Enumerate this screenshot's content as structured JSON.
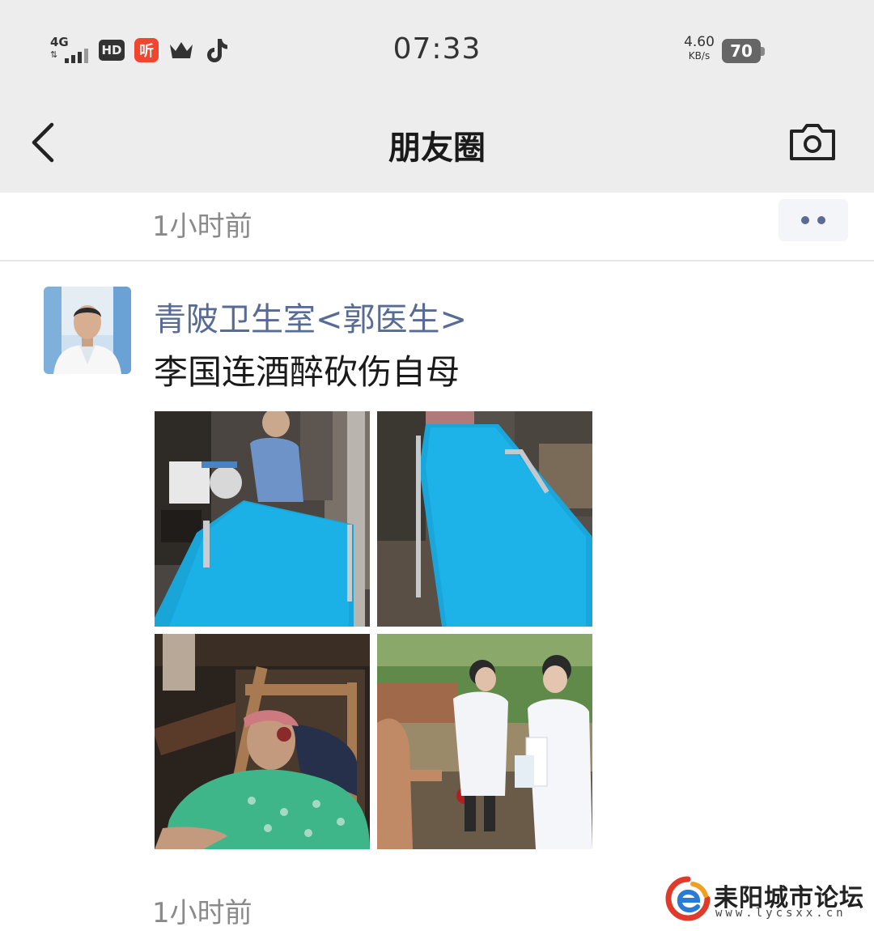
{
  "status_bar": {
    "network": "4G",
    "hd_badge": "HD",
    "app_icon_text": "听",
    "time": "07:33",
    "speed_value": "4.60",
    "speed_unit": "KB/s",
    "battery": "70"
  },
  "nav": {
    "title": "朋友圈",
    "back_icon": "chevron-left-icon",
    "camera_icon": "camera-icon"
  },
  "feed": {
    "previous_post_time": "1小时前",
    "more_icon": "more-dots-icon",
    "post": {
      "author": "青陂卫生室<郭医生>",
      "text": "李国连酒醉砍伤自母",
      "time": "1小时前",
      "photo_count": 4
    }
  },
  "watermark": {
    "title": "耒阳城市论坛",
    "url": "www.lycsxx.cn"
  },
  "colors": {
    "bar_bg": "#ededed",
    "link": "#576b95",
    "meta_gray": "#8a8a8a"
  }
}
